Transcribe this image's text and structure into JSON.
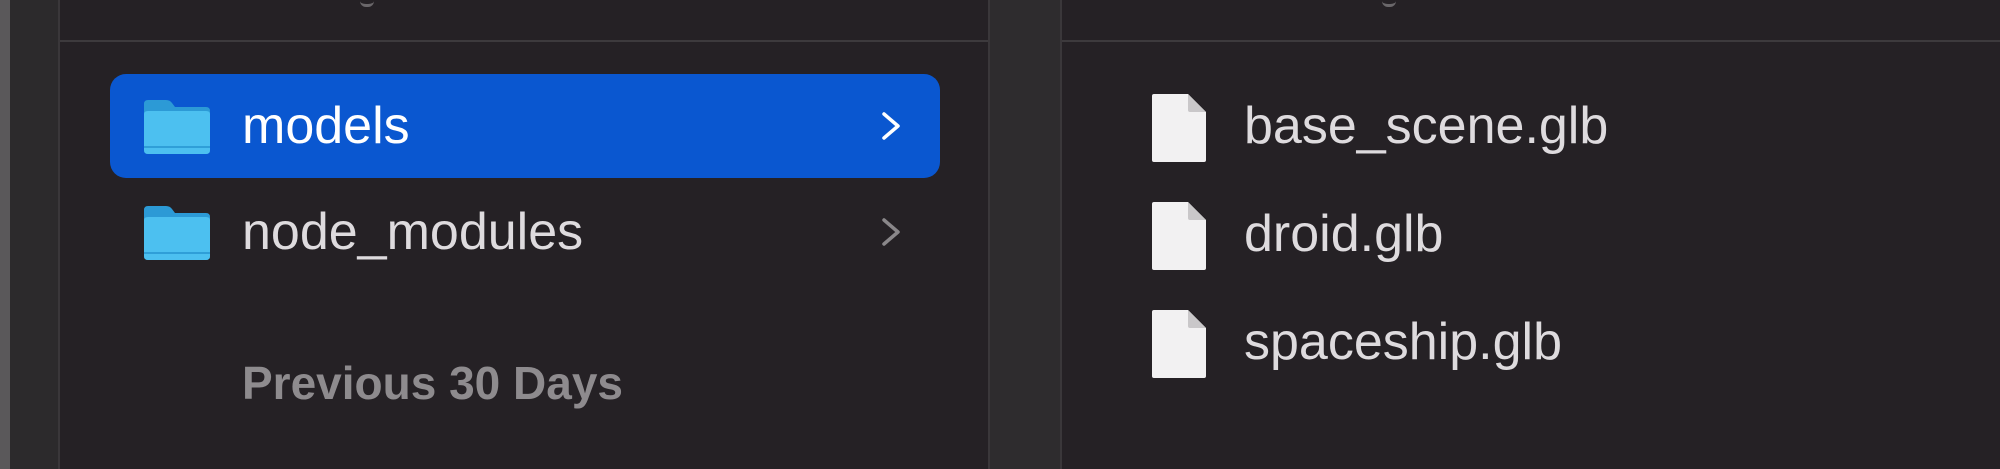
{
  "left_column": {
    "items": [
      {
        "label": "models",
        "icon": "folder-icon",
        "selected": true
      },
      {
        "label": "node_modules",
        "icon": "folder-icon",
        "selected": false
      }
    ],
    "section_header": "Previous 30 Days"
  },
  "right_column": {
    "files": [
      {
        "label": "base_scene.glb",
        "icon": "document-icon"
      },
      {
        "label": "droid.glb",
        "icon": "document-icon"
      },
      {
        "label": "spaceship.glb",
        "icon": "document-icon"
      }
    ]
  },
  "colors": {
    "selection": "#0a57d0",
    "folder": "#3cb4ec",
    "background": "#252125",
    "text": "#dedbde",
    "section_text": "#8e8b8e"
  }
}
